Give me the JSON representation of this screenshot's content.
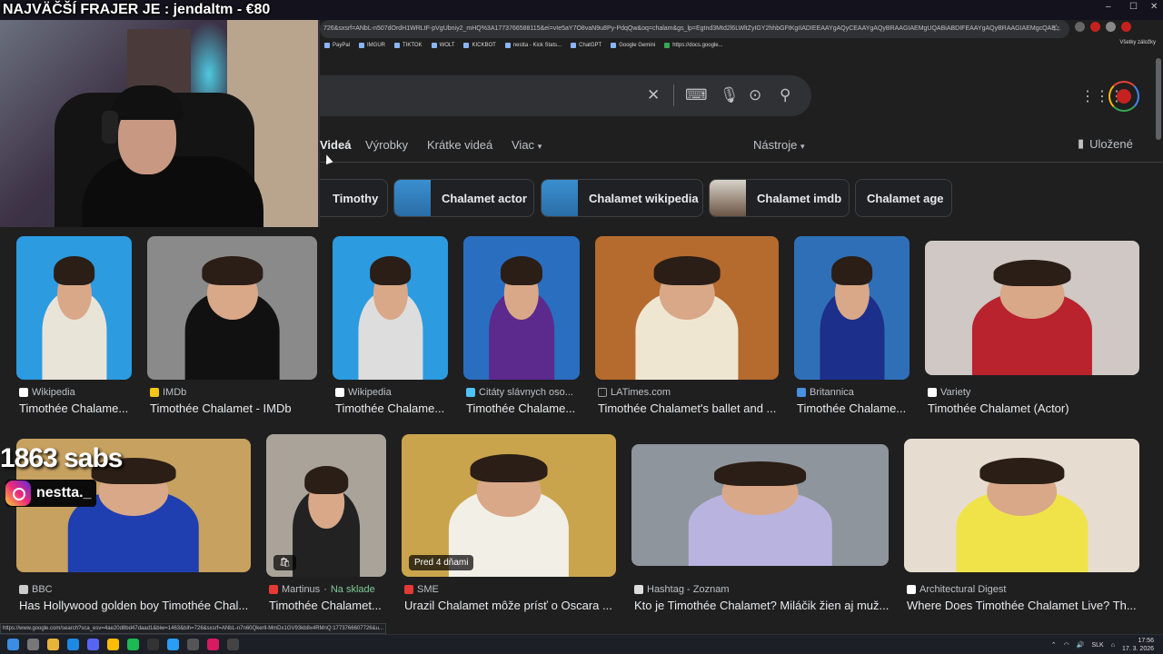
{
  "overlay": {
    "title": "NAJVÄČŠÍ FRAJER JE : jendaltm - €80",
    "subs": "1863 sabs",
    "instagram": "nestta._"
  },
  "browser": {
    "url": "726&sxsrf=ANbL-n507dOrdH1WRLtF-pVgUbniy2_mHQ%3A1773766588115&ei=vIe5aY7O8vaN9u8Py-PdqQw&oq=chalam&gs_lp=Egtnd3Mtd2l6LWltZyIGY2hhbGFtKgIIADIEEAAYgAQyCEAAYgAQyBRAAGIAEMgUQABiABDIFEAAYgAQyBRAAGIAEMgcQAB...",
    "bookmarks": [
      "PayPal",
      "IMGUR",
      "TIKTOK",
      "WOLT",
      "KICKBOT",
      "nestta - Kick Stats...",
      "ChatGPT",
      "Google Gemini",
      "https://docs.google..."
    ],
    "bookmarks_right": "Všetky záložky",
    "status_url": "https://www.google.com/search?sca_esv=4ae20d8bd47daad1&biw=1463&bih=726&sxsrf=ANbL-n7n60Qkerll-MmDx1GV93kb8x4RMnQ:1773766607726&u..."
  },
  "tabs": {
    "items": [
      "Videá",
      "Výrobky",
      "Krátke videá",
      "Viac",
      "Nástroje"
    ],
    "saved": "Uložené"
  },
  "chips": [
    "Timothy",
    "Chalamet actor",
    "Chalamet wikipedia",
    "Chalamet imdb",
    "Chalamet age"
  ],
  "results": [
    {
      "source": "Wikipedia",
      "title": "Timothée Chalame..."
    },
    {
      "source": "IMDb",
      "title": "Timothée Chalamet - IMDb"
    },
    {
      "source": "Wikipedia",
      "title": "Timothée Chalame..."
    },
    {
      "source": "Citáty slávnych oso...",
      "title": "Timothée Chalame..."
    },
    {
      "source": "LATimes.com",
      "title": "Timothée Chalamet's ballet and ..."
    },
    {
      "source": "Britannica",
      "title": "Timothée Chalame..."
    },
    {
      "source": "Variety",
      "title": "Timothée Chalamet (Actor)"
    },
    {
      "source": "BBC",
      "title": "Has Hollywood golden boy Timothée Chal..."
    },
    {
      "source": "Martinus",
      "stock": "Na sklade",
      "title": "Timothée Chalamet..."
    },
    {
      "source": "SME",
      "title": "Urazil Chalamet môže prísť o Oscara ...",
      "badge": "Pred 4 dňami"
    },
    {
      "source": "Hashtag - Zoznam",
      "title": "Kto je Timothée Chalamet? Miláčik žien aj muž..."
    },
    {
      "source": "Architectural Digest",
      "title": "Where Does Timothée Chalamet Live? Th..."
    }
  ],
  "taskbar": {
    "lang": "SLK",
    "time": "17:56",
    "date": "17. 3. 2026"
  },
  "colors": {
    "background": "#1f1f1f",
    "searchbar": "#303134",
    "text": "#e8eaed",
    "muted": "#bdc1c6",
    "in_stock": "#81c995"
  }
}
